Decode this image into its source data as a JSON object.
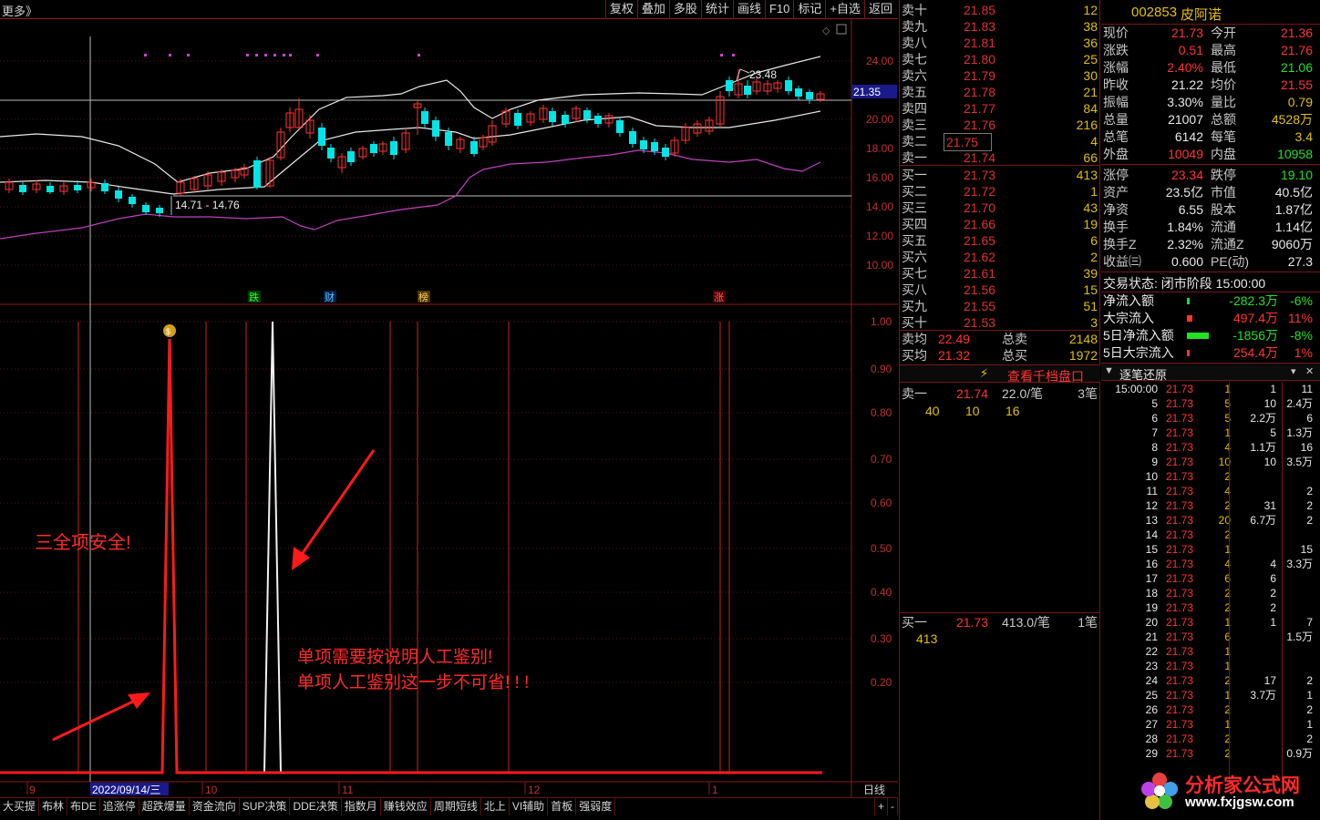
{
  "topbar": {
    "more": "更多》",
    "buttons": [
      "复权",
      "叠加",
      "多股",
      "统计",
      "画线",
      "F10",
      "标记",
      "+自选",
      "返回"
    ]
  },
  "chart": {
    "price_axis": [
      "24.00",
      "22.00",
      "21.35",
      "20.00",
      "18.00",
      "16.00",
      "14.00",
      "12.00",
      "10.00"
    ],
    "current_price_tag": "21.35",
    "hi_label": "23.48",
    "range_label": "14.71 - 14.76",
    "event_markers": [
      "跌",
      "财",
      "榜",
      "涨"
    ],
    "ind_axis": [
      "1.00",
      "0.90",
      "0.80",
      "0.70",
      "0.60",
      "0.50",
      "0.40",
      "0.30",
      "0.20"
    ],
    "date_axis": [
      "9",
      "2022/09/14/三",
      "10",
      "11",
      "12",
      "1"
    ],
    "period": "日线",
    "annot_1": "三全项安全!",
    "annot_2": "单项需要按说明人工鉴别!",
    "annot_3": "单项人工鉴别这一步不可省! ! !",
    "zoom_plus": "+",
    "zoom_minus": "-"
  },
  "bottom_tabs": [
    "大买提",
    "布林",
    "布DE",
    "追涨停",
    "超跌爆量",
    "资金流向",
    "SUP决策",
    "DDE决策",
    "指数月",
    "赚钱效应",
    "周期短线",
    "北上",
    "VI辅助",
    "首板",
    "强弱度"
  ],
  "orderbook": {
    "sells": [
      {
        "l": "卖十",
        "p": "21.85",
        "v": "12"
      },
      {
        "l": "卖九",
        "p": "21.83",
        "v": "38"
      },
      {
        "l": "卖八",
        "p": "21.81",
        "v": "36"
      },
      {
        "l": "卖七",
        "p": "21.80",
        "v": "25"
      },
      {
        "l": "卖六",
        "p": "21.79",
        "v": "30"
      },
      {
        "l": "卖五",
        "p": "21.78",
        "v": "21"
      },
      {
        "l": "卖四",
        "p": "21.77",
        "v": "84"
      },
      {
        "l": "卖三",
        "p": "21.76",
        "v": "216"
      },
      {
        "l": "卖二",
        "p": "21.75",
        "v": "4"
      },
      {
        "l": "卖一",
        "p": "21.74",
        "v": "66"
      }
    ],
    "buys": [
      {
        "l": "买一",
        "p": "21.73",
        "v": "413"
      },
      {
        "l": "买二",
        "p": "21.72",
        "v": "1"
      },
      {
        "l": "买三",
        "p": "21.70",
        "v": "43"
      },
      {
        "l": "买四",
        "p": "21.66",
        "v": "19"
      },
      {
        "l": "买五",
        "p": "21.65",
        "v": "6"
      },
      {
        "l": "买六",
        "p": "21.62",
        "v": "2"
      },
      {
        "l": "买七",
        "p": "21.61",
        "v": "39"
      },
      {
        "l": "买八",
        "p": "21.56",
        "v": "15"
      },
      {
        "l": "买九",
        "p": "21.55",
        "v": "51"
      },
      {
        "l": "买十",
        "p": "21.53",
        "v": "3"
      }
    ],
    "avg_sell_label": "卖均",
    "avg_sell": "22.49",
    "total_sell_label": "总卖",
    "total_sell": "2148",
    "avg_buy_label": "买均",
    "avg_buy": "21.32",
    "total_buy_label": "总买",
    "total_buy": "1972",
    "qianding": "查看千档盘口",
    "s1_label": "卖一",
    "s1_price": "21.74",
    "s1_per": "22.0/笔",
    "s1_cnt": "3笔",
    "s1_queue": [
      "40",
      "10",
      "16"
    ],
    "b1_label": "买一",
    "b1_price": "21.73",
    "b1_per": "413.0/笔",
    "b1_cnt": "1笔",
    "b1_queue": [
      "413"
    ]
  },
  "quote": {
    "code": "002853",
    "name": "皮阿诺",
    "rows": [
      [
        "现价",
        "21.73",
        "今开",
        "21.36"
      ],
      [
        "涨跌",
        "0.51",
        "最高",
        "21.76"
      ],
      [
        "涨幅",
        "2.40%",
        "最低",
        "21.06"
      ],
      [
        "昨收",
        "21.22",
        "均价",
        "21.55"
      ],
      [
        "振幅",
        "3.30%",
        "量比",
        "0.79"
      ],
      [
        "总量",
        "21007",
        "总额",
        "4528万"
      ],
      [
        "总笔",
        "6142",
        "每笔",
        "3.4"
      ],
      [
        "外盘",
        "10049",
        "内盘",
        "10958"
      ],
      [
        "涨停",
        "23.34",
        "跌停",
        "19.10"
      ],
      [
        "资产",
        "23.5亿",
        "市值",
        "40.5亿"
      ],
      [
        "净资",
        "6.55",
        "股本",
        "1.87亿"
      ],
      [
        "换手",
        "1.84%",
        "流通",
        "1.14亿"
      ],
      [
        "换手Z",
        "2.32%",
        "流通Z",
        "9060万"
      ],
      [
        "收益㈢",
        "0.600",
        "PE(动)",
        "27.3"
      ]
    ],
    "trade_status": "交易状态: 闭市阶段 15:00:00",
    "flows": [
      {
        "label": "净流入额",
        "value": "-282.3万",
        "pct": "-6%"
      },
      {
        "label": "大宗流入",
        "value": "497.4万",
        "pct": "11%"
      },
      {
        "label": "5日净流入额",
        "value": "-1856万",
        "pct": "-8%"
      },
      {
        "label": "5日大宗流入",
        "value": "254.4万",
        "pct": "1%"
      }
    ],
    "tick_title": "逐笔还原",
    "ticks": [
      [
        "15:00:00",
        "21.73",
        "1",
        "1",
        "11"
      ],
      [
        "5",
        "21.73",
        "5",
        "10",
        "2.4万"
      ],
      [
        "6",
        "21.73",
        "5",
        "2.2万",
        "6"
      ],
      [
        "7",
        "21.73",
        "1",
        "5",
        "1.3万"
      ],
      [
        "8",
        "21.73",
        "4",
        "1.1万",
        "16"
      ],
      [
        "9",
        "21.73",
        "10",
        "10",
        "3.5万"
      ],
      [
        "10",
        "21.73",
        "2",
        "",
        ""
      ],
      [
        "11",
        "21.73",
        "4",
        "",
        "2"
      ],
      [
        "12",
        "21.73",
        "2",
        "31",
        "2"
      ],
      [
        "13",
        "21.73",
        "20",
        "6.7万",
        "2"
      ],
      [
        "14",
        "21.73",
        "2",
        "",
        ""
      ],
      [
        "15",
        "21.73",
        "1",
        "",
        "15"
      ],
      [
        "16",
        "21.73",
        "4",
        "4",
        "3.3万"
      ],
      [
        "17",
        "21.73",
        "6",
        "6",
        ""
      ],
      [
        "18",
        "21.73",
        "2",
        "2",
        ""
      ],
      [
        "19",
        "21.73",
        "2",
        "2",
        ""
      ],
      [
        "20",
        "21.73",
        "1",
        "1",
        "7"
      ],
      [
        "21",
        "21.73",
        "6",
        "",
        "1.5万"
      ],
      [
        "22",
        "21.73",
        "1",
        "",
        ""
      ],
      [
        "23",
        "21.73",
        "1",
        "",
        ""
      ],
      [
        "24",
        "21.73",
        "2",
        "17",
        "2"
      ],
      [
        "25",
        "21.73",
        "1",
        "3.7万",
        "1"
      ],
      [
        "26",
        "21.73",
        "2",
        "",
        "2"
      ],
      [
        "27",
        "21.73",
        "1",
        "",
        "1"
      ],
      [
        "28",
        "21.73",
        "2",
        "",
        "2"
      ],
      [
        "29",
        "21.73",
        "2",
        "",
        "0.9万"
      ]
    ],
    "watermark_name": "分析家公式网",
    "watermark_url": "www.fxjgsw.com"
  }
}
